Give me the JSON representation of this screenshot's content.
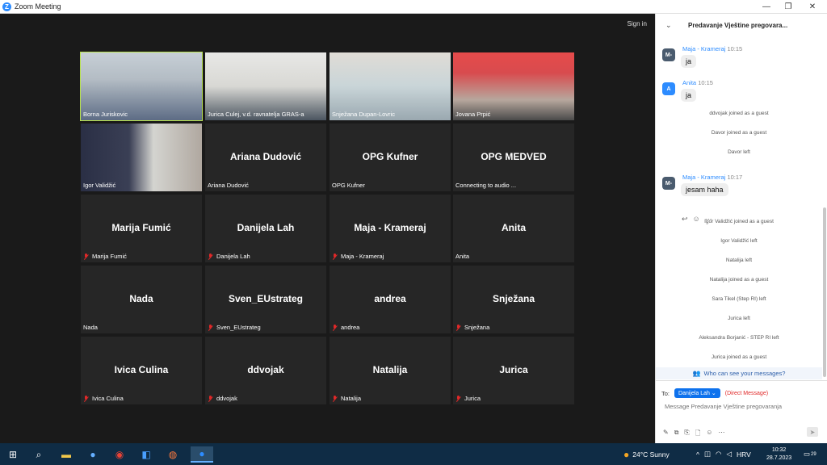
{
  "window": {
    "title": "Zoom Meeting",
    "minimize": "—",
    "restore": "❐",
    "close": "✕"
  },
  "meeting": {
    "sign_in": "Sign in",
    "tiles": [
      {
        "name": "Borna Juriskovic",
        "big": "",
        "video": true,
        "active": true,
        "muted": false
      },
      {
        "name": "Jurica Culej, v.d. ravnatelja GRAS-a",
        "big": "",
        "video": true,
        "active": false,
        "muted": false
      },
      {
        "name": "Snježana Dupan-Lovric",
        "big": "",
        "video": true,
        "active": false,
        "muted": false
      },
      {
        "name": "Jovana Prpić",
        "big": "",
        "video": true,
        "active": false,
        "muted": false
      },
      {
        "name": "Igor Validžić",
        "big": "",
        "video": true,
        "active": false,
        "muted": false
      },
      {
        "name": "Ariana Dudović",
        "big": "Ariana Dudović",
        "video": false,
        "active": false,
        "muted": false
      },
      {
        "name": "OPG Kufner",
        "big": "OPG Kufner",
        "video": false,
        "active": false,
        "muted": false
      },
      {
        "name": "Connecting to audio ...",
        "big": "OPG MEDVED",
        "video": false,
        "active": false,
        "muted": false
      },
      {
        "name": "Marija Fumić",
        "big": "Marija Fumić",
        "video": false,
        "active": false,
        "muted": true
      },
      {
        "name": "Danijela Lah",
        "big": "Danijela Lah",
        "video": false,
        "active": false,
        "muted": true
      },
      {
        "name": "Maja - Krameraj",
        "big": "Maja - Krameraj",
        "video": false,
        "active": false,
        "muted": true
      },
      {
        "name": "Anita",
        "big": "Anita",
        "video": false,
        "active": false,
        "muted": false
      },
      {
        "name": "Nada",
        "big": "Nada",
        "video": false,
        "active": false,
        "muted": false
      },
      {
        "name": "Sven_EUstrateg",
        "big": "Sven_EUstrateg",
        "video": false,
        "active": false,
        "muted": true
      },
      {
        "name": "andrea",
        "big": "andrea",
        "video": false,
        "active": false,
        "muted": true
      },
      {
        "name": "Snježana",
        "big": "Snježana",
        "video": false,
        "active": false,
        "muted": true
      },
      {
        "name": "Ivica Culina",
        "big": "Ivica Culina",
        "video": false,
        "active": false,
        "muted": true
      },
      {
        "name": "ddvojak",
        "big": "ddvojak",
        "video": false,
        "active": false,
        "muted": true
      },
      {
        "name": "Natalija",
        "big": "Natalija",
        "video": false,
        "active": false,
        "muted": true
      },
      {
        "name": "Jurica",
        "big": "Jurica",
        "video": false,
        "active": false,
        "muted": true
      }
    ]
  },
  "chat": {
    "title": "Predavanje Vještine pregovara...",
    "messages": [
      {
        "avatar": "M-",
        "avatar_color": "#4a5b6e",
        "sender": "Maja - Krameraj",
        "time": "10:15",
        "text": "ja"
      },
      {
        "avatar": "A",
        "avatar_color": "#2d8cff",
        "sender": "Anita",
        "time": "10:15",
        "text": "ja"
      },
      {
        "avatar": "M-",
        "avatar_color": "#4a5b6e",
        "sender": "Maja - Krameraj",
        "time": "10:17",
        "text": "jesam haha"
      }
    ],
    "system_top": [
      "ddvojak joined as a guest",
      "Davor joined as a guest",
      "Davor left"
    ],
    "system_bottom": [
      "Igor Validžić joined as a guest",
      "Igor Validžić left",
      "Natalija left",
      "Natalija joined as a guest",
      "Sara Tikel (Step RI) left",
      "Jurica left",
      "Aleksandra Borjanić - STEP RI left",
      "Jurica joined as a guest"
    ],
    "who_can_see": "Who can see your messages?",
    "to_label": "To:",
    "recipient": "Danijela Lah",
    "direct_message": "(Direct Message)",
    "input_placeholder": "Message Predavanje Vještine pregovaranja"
  },
  "taskbar": {
    "weather": "24°C  Sunny",
    "lang": "HRV",
    "time": "10:32",
    "date": "28.7.2023",
    "notif": "29"
  }
}
